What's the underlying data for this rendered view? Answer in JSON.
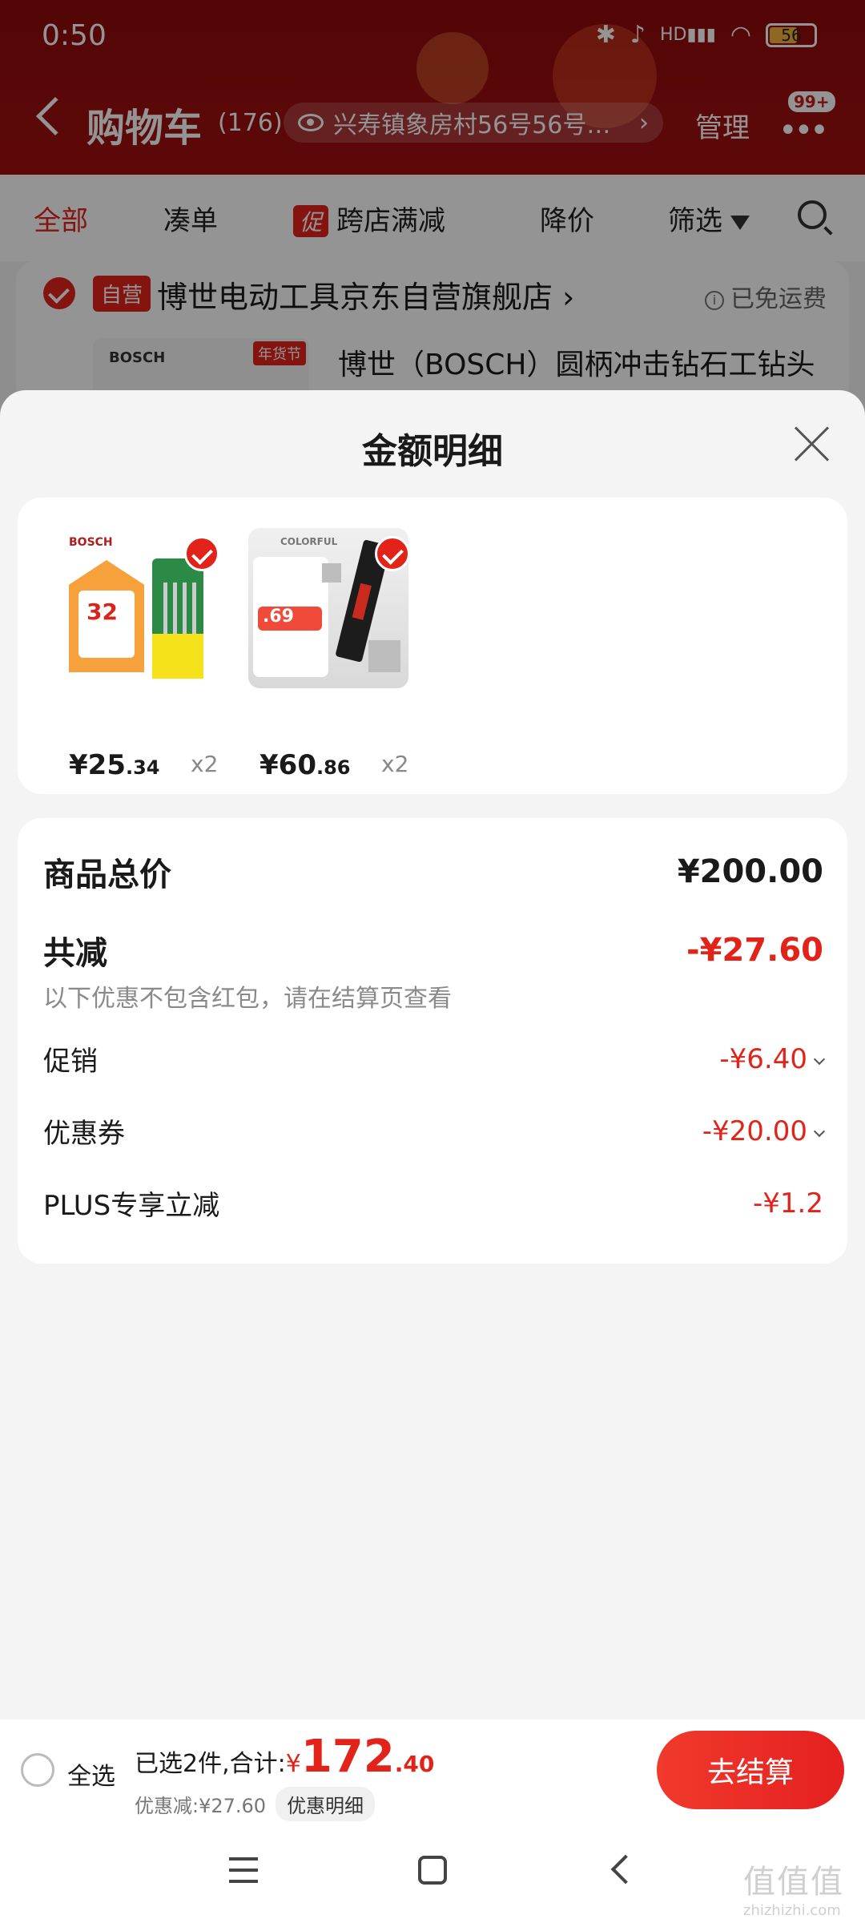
{
  "status_bar": {
    "time": "0:50",
    "battery": "56",
    "network": "HD"
  },
  "header": {
    "title": "购物车",
    "count": "(176)",
    "address": "兴寿镇象房村56号56号…",
    "manage_label": "管理",
    "more_badge": "99+"
  },
  "filters": {
    "tabs": [
      "全部",
      "凑单",
      "跨店满减",
      "降价",
      "筛选"
    ],
    "promo_tag": "促"
  },
  "store": {
    "self_tag": "自营",
    "name": "博世电动工具京东自营旗舰店",
    "shipping": "已免运费",
    "product_brand": "BOSCH",
    "product_tag": "年货节",
    "product_title": "博世（BOSCH）圆柄冲击钻石工钻头"
  },
  "sheet": {
    "title": "金额明细",
    "items": [
      {
        "price_int": "¥25",
        "price_dec": ".34",
        "qty": "x2",
        "brand": "BOSCH",
        "promo_number": "32"
      },
      {
        "price_int": "¥60",
        "price_dec": ".86",
        "qty": "x2",
        "brand": "COLORFUL",
        "promo_number": ".69"
      }
    ],
    "details": {
      "total_label": "商品总价",
      "total_value": "¥200.00",
      "reduce_label": "共减",
      "reduce_value": "-¥27.60",
      "note": "以下优惠不包含红包，请在结算页查看",
      "promo_label": "促销",
      "promo_value": "-¥6.40",
      "coupon_label": "优惠券",
      "coupon_value": "-¥20.00",
      "plus_label": "PLUS专享立减",
      "plus_value": "-¥1.2"
    }
  },
  "bottom": {
    "select_all": "全选",
    "summary_prefix": "已选2件,合计:",
    "yen": "¥",
    "amount_int": "172",
    "amount_dec": ".40",
    "discount": "优惠减:¥27.60",
    "detail_button": "优惠明细",
    "checkout": "去结算"
  },
  "watermark": {
    "text": "值值值",
    "url": "zhizhizhi.com"
  },
  "colors": {
    "accent": "#e2231a",
    "header": "#a20f10"
  }
}
